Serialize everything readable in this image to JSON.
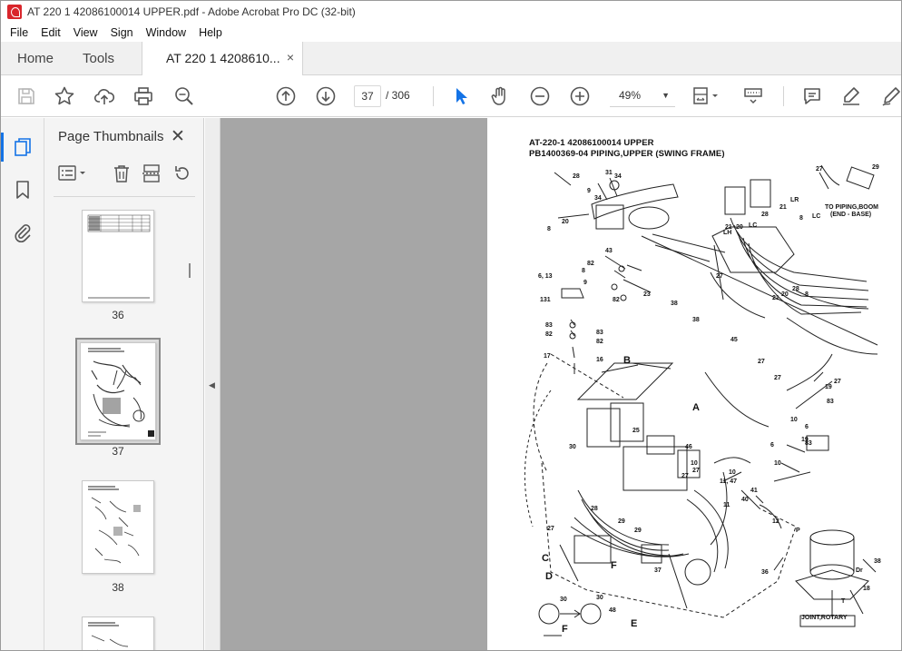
{
  "window": {
    "title": "AT 220 1 42086100014 UPPER.pdf - Adobe Acrobat Pro DC (32-bit)"
  },
  "menu": [
    "File",
    "Edit",
    "View",
    "Sign",
    "Window",
    "Help"
  ],
  "tabs": {
    "home": "Home",
    "tools": "Tools",
    "document": "AT 220 1 4208610...",
    "close": "×"
  },
  "toolbar": {
    "current_page": "37",
    "page_separator_total": "/   306",
    "zoom": "49%",
    "icons": [
      "save-icon",
      "bookmark-star-icon",
      "upload-icon",
      "print-icon",
      "find-zoom-icon",
      "prev-page-icon",
      "next-page-icon",
      "select-arrow-icon",
      "hand-icon",
      "zoom-out-icon",
      "zoom-in-icon",
      "fit-page-icon",
      "scroll-mode-icon",
      "comment-icon",
      "highlight-icon",
      "sign-icon"
    ]
  },
  "panel": {
    "title": "Page Thumbnails",
    "thumbnails": [
      {
        "label": "36"
      },
      {
        "label": "37"
      },
      {
        "label": "38"
      }
    ]
  },
  "document": {
    "title_line1": "AT-220-1 42086100014 UPPER",
    "title_line2": "PB1400369-04 PIPING,UPPER (SWING FRAME)",
    "note_piping": "TO PIPING,BOOM",
    "note_piping2": "(END - BASE)",
    "note_joint": "JOINT,ROTARY",
    "callouts_big": [
      "A",
      "B",
      "C",
      "D",
      "E",
      "F",
      "F"
    ],
    "callouts": [
      "28",
      "31",
      "34",
      "9",
      "34",
      "20",
      "27",
      "29",
      "43",
      "82",
      "23",
      "6, 13",
      "131",
      "83",
      "82",
      "83",
      "82",
      "17",
      "16",
      "21",
      "20",
      "LC",
      "28",
      "21",
      "8",
      "LR",
      "LH",
      "LC",
      "27",
      "38",
      "38",
      "45",
      "28",
      "20",
      "8",
      "21",
      "27",
      "27",
      "27",
      "19",
      "83",
      "10",
      "6",
      "19",
      "10",
      "6",
      "83",
      "10",
      "25",
      "46",
      "30",
      "27",
      "10",
      "10",
      "11, 47",
      "41",
      "40",
      "11",
      "12",
      "29",
      "28",
      "27",
      "37",
      "36",
      "38",
      "Dr",
      "18",
      "30",
      "30",
      "48",
      "P",
      "T"
    ],
    "colors": {
      "accent": "#1473e6",
      "rail_bg": "#f4f4f4",
      "doc_gray": "#a6a6a6"
    }
  }
}
